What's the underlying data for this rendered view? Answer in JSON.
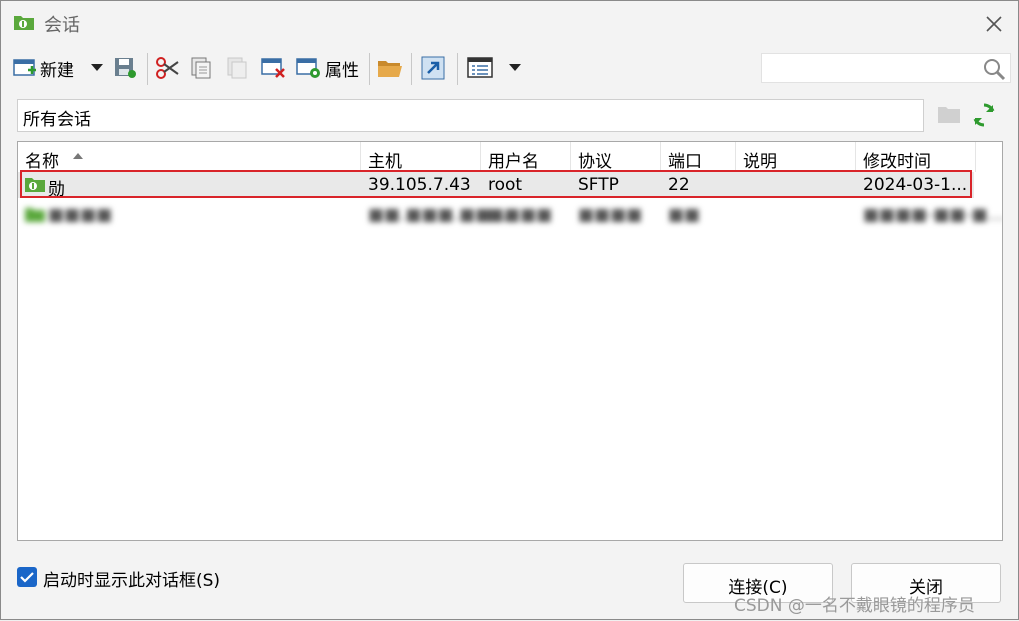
{
  "window": {
    "title": "会话"
  },
  "toolbar": {
    "new_label": "新建",
    "properties_label": "属性"
  },
  "path": {
    "text": "所有会话"
  },
  "columns": [
    "名称",
    "主机",
    "用户名",
    "协议",
    "端口",
    "说明",
    "修改时间"
  ],
  "sessions": [
    {
      "name": "勋",
      "host": "39.105.7.43",
      "user": "root",
      "protocol": "SFTP",
      "port": "22",
      "description": "",
      "modified": "2024-03-1..."
    },
    {
      "name": "■■■■",
      "host": "■■.■■■.■■...",
      "user": "■■■■",
      "protocol": "■■■■",
      "port": "■■",
      "description": "",
      "modified": "■■■■-■■-■..."
    }
  ],
  "footer": {
    "startup_checkbox_label": "启动时显示此对话框(S)",
    "connect_label": "连接(C)",
    "close_label": "关闭"
  },
  "watermark": "CSDN @一名不戴眼镜的程序员",
  "colors": {
    "highlight_border": "#d9242a",
    "accent": "#1a66c8"
  }
}
